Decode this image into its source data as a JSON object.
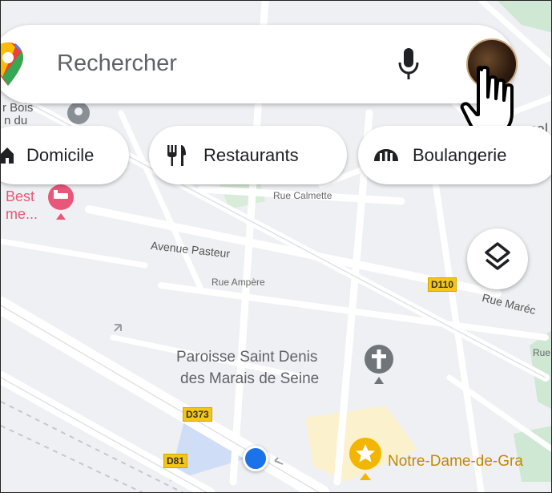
{
  "search": {
    "placeholder": "Rechercher"
  },
  "chips": [
    {
      "label": "Domicile",
      "icon": "home-icon"
    },
    {
      "label": "Restaurants",
      "icon": "fork-knife-icon"
    },
    {
      "label": "Boulangerie",
      "icon": "bread-icon"
    }
  ],
  "map_labels": {
    "street_calmette": "Rue Calmette",
    "avenue_pasteur": "Avenue Pasteur",
    "rue_ampere": "Rue Ampère",
    "rue_mareo": "Rue Maréc",
    "rue_right": "Rue",
    "paroisse_line1": "Paroisse Saint Denis",
    "paroisse_line2": "des Marais de Seine",
    "notre_dame": "Notre-Dame-de-Gra",
    "best_line1": "Best",
    "best_line2": "me...",
    "top_left_1": "r Bois",
    "top_left_2": "n du",
    "top_right": "cal",
    "d110": "D110",
    "d373": "D373",
    "d81": "D81"
  },
  "colors": {
    "accent_blue": "#1a73e8",
    "hotel_pink": "#e8577a",
    "church_gray": "#70757a",
    "star_gold": "#f2b600",
    "road_badge": "#f5c518"
  }
}
